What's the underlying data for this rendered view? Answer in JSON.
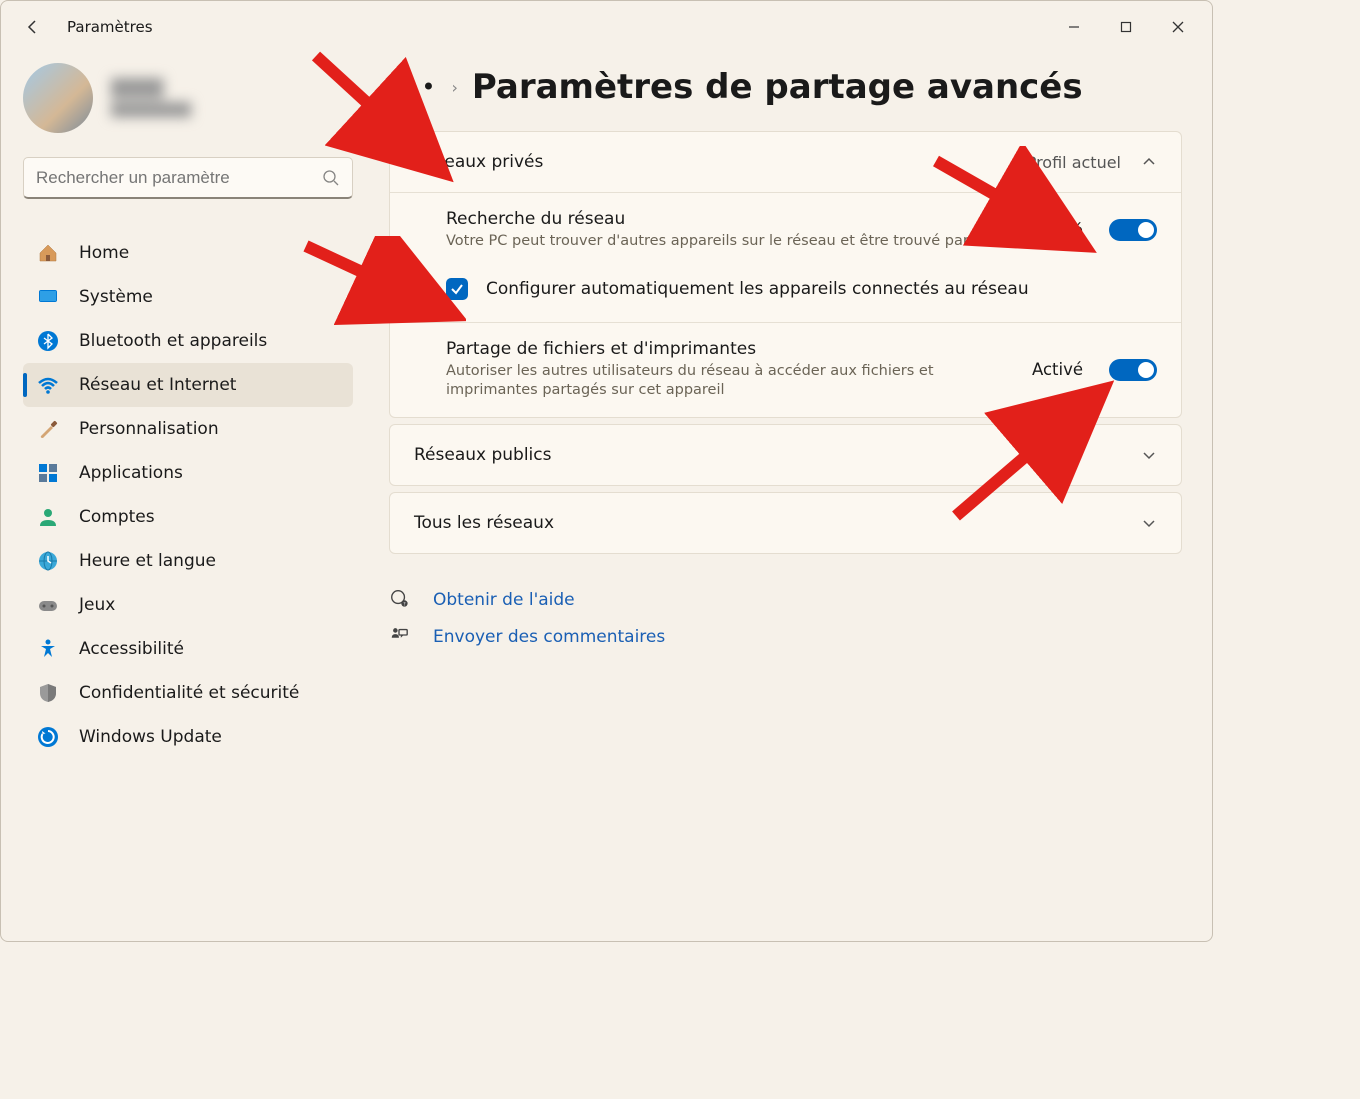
{
  "app_title": "Paramètres",
  "search_placeholder": "Rechercher un paramètre",
  "profile": {
    "name": "████",
    "email": "████████"
  },
  "nav": {
    "home": "Home",
    "system": "Système",
    "bluetooth": "Bluetooth et appareils",
    "network": "Réseau et Internet",
    "personalization": "Personnalisation",
    "apps": "Applications",
    "accounts": "Comptes",
    "time": "Heure et langue",
    "games": "Jeux",
    "accessibility": "Accessibilité",
    "privacy": "Confidentialité et sécurité",
    "update": "Windows Update"
  },
  "breadcrumb": {
    "title": "Paramètres de partage avancés"
  },
  "private": {
    "header": "Réseaux privés",
    "profile_tag": "Profil actuel",
    "discovery": {
      "title": "Recherche du réseau",
      "sub": "Votre PC peut trouver d'autres appareils sur le réseau et être trouvé par eux",
      "state": "Activé"
    },
    "autoconf": "Configurer automatiquement les appareils connectés au réseau",
    "sharing": {
      "title": "Partage de fichiers et d'imprimantes",
      "sub": "Autoriser les autres utilisateurs du réseau à accéder aux fichiers et imprimantes partagés sur cet appareil",
      "state": "Activé"
    }
  },
  "public": {
    "header": "Réseaux publics"
  },
  "all": {
    "header": "Tous les réseaux"
  },
  "help": {
    "get_help": "Obtenir de l'aide",
    "feedback": "Envoyer des commentaires"
  }
}
